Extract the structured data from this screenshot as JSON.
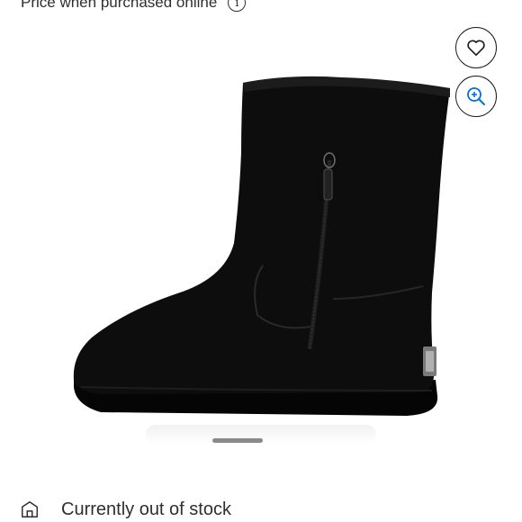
{
  "price_note": {
    "label": "Price when purchased online",
    "info_icon": "info-icon",
    "info_glyph": "i"
  },
  "product": {
    "image_alt": "Black suede boot with side zipper",
    "image_icon": "boot-photo"
  },
  "actions": {
    "favorite_icon": "heart-icon",
    "zoom_icon": "zoom-in-icon"
  },
  "carousel": {
    "active_index": 0
  },
  "availability": {
    "icon": "store-icon",
    "text": "Currently out of stock"
  },
  "colors": {
    "text": "#2e2f32",
    "boot": "#0c0c0c",
    "button_border": "#1a1a1a",
    "zoom_accent": "#0071dc"
  }
}
